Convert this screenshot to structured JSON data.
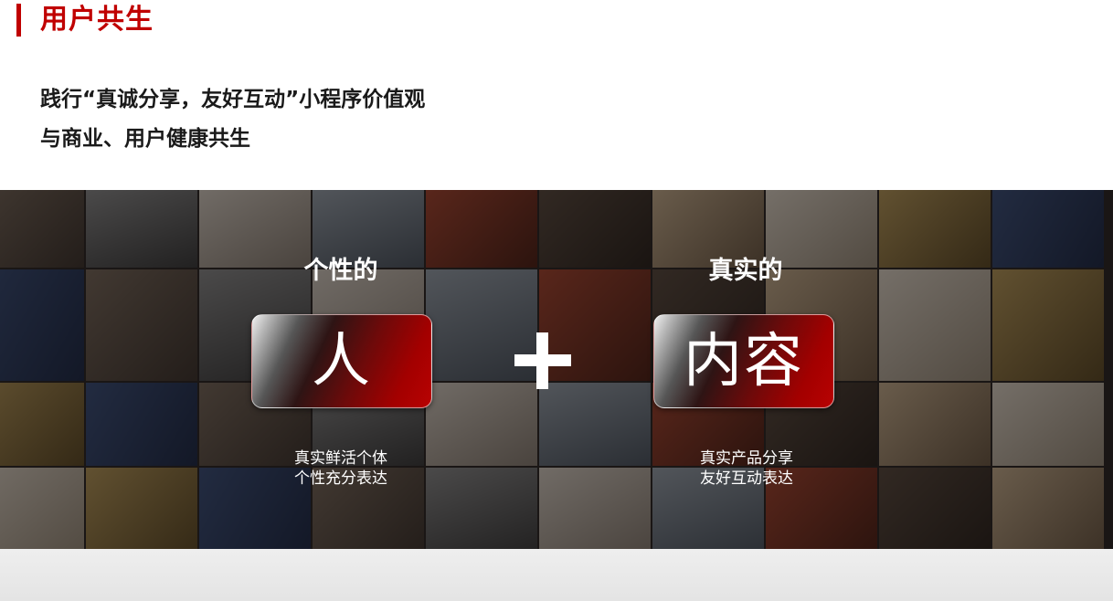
{
  "header": {
    "title": "用户共生",
    "accent_color": "#c00000"
  },
  "subtitle": {
    "line1": "践行“真诚分享，友好互动”小程序价值观",
    "line2": "与商业、用户健康共生"
  },
  "left": {
    "label": "个性的",
    "box_text": "人",
    "desc_line1": "真实鲜活个体",
    "desc_line2": "个性充分表达"
  },
  "right": {
    "label": "真实的",
    "box_text": "内容",
    "desc_line1": "真实产品分享",
    "desc_line2": "友好互动表达"
  },
  "operator": "plus-icon"
}
